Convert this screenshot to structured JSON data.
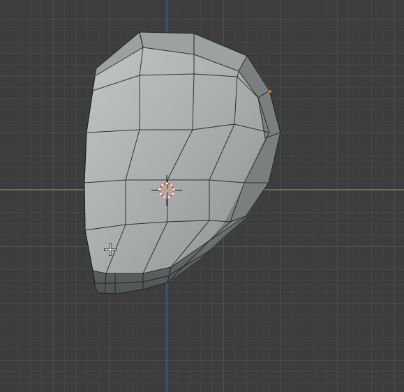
{
  "viewport": {
    "background": "#3d3d3d",
    "grid_minor_color": "#454545",
    "grid_major_color": "#4f4f4f",
    "x_axis_color": "#7b9a2b",
    "y_axis_color": "#2f6fb0"
  },
  "mesh": {
    "type": "low-poly-sculpt",
    "shading": "solid",
    "face_colors": [
      "#b3b6b6",
      "#9ea2a2",
      "#8a8e8e",
      "#6f7373",
      "#5a5d5d"
    ],
    "edge_color": "#1c1c1c",
    "selected_vertex_color": "#ff8a1c"
  },
  "cursor_3d": {
    "icon": "3d-cursor-icon",
    "ring_colors": [
      "#ff4040",
      "#ffffff"
    ],
    "center_color": "#e8a32a"
  },
  "mouse_cursor": {
    "icon": "crosshair-cursor-icon"
  }
}
